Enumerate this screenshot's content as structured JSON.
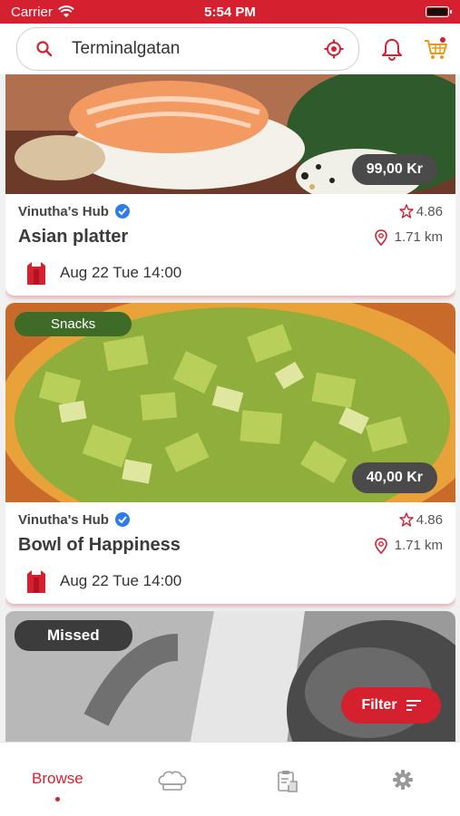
{
  "status_bar": {
    "carrier": "Carrier",
    "time": "5:54 PM"
  },
  "search": {
    "value": "Terminalgatan",
    "placeholder": ""
  },
  "colors": {
    "brand": "#d4202f",
    "snacks_tag": "#3f6b28",
    "pill": "#4a4a4a",
    "verified": "#2b7de9"
  },
  "cards": [
    {
      "tag": "",
      "price": "99,00 Kr",
      "vendor": "Vinutha's Hub",
      "rating": "4.86",
      "title": "Asian platter",
      "distance": "1.71 km",
      "pickup": "Aug 22 Tue 14:00",
      "image": "sushi-photo"
    },
    {
      "tag": "Snacks",
      "price": "40,00 Kr",
      "vendor": "Vinutha's Hub",
      "rating": "4.86",
      "title": "Bowl of Happiness",
      "distance": "1.71 km",
      "pickup": "Aug 22 Tue 14:00",
      "image": "avocado-photo"
    },
    {
      "tag": "Missed",
      "image": "missed-grayscale-photo"
    }
  ],
  "filter": {
    "label": "Filter"
  },
  "tabs": [
    {
      "label": "Browse",
      "icon": "browse",
      "active": true
    },
    {
      "label": "",
      "icon": "chef-hat-icon"
    },
    {
      "label": "",
      "icon": "orders-icon"
    },
    {
      "label": "",
      "icon": "gear-icon"
    }
  ]
}
